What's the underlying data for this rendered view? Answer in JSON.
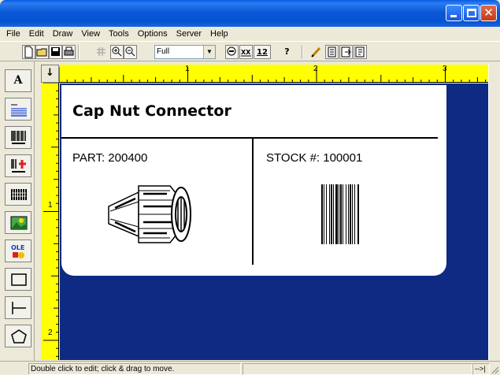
{
  "menubar": {
    "items": [
      "File",
      "Edit",
      "Draw",
      "View",
      "Tools",
      "Options",
      "Server",
      "Help"
    ]
  },
  "toolbar": {
    "zoom_value": "Full",
    "btn_12": "12",
    "btn_help": "?"
  },
  "palette": {
    "text_tool": "A"
  },
  "ruler": {
    "corner_glyph": "↓",
    "top_marks": [
      "1",
      "2",
      "3"
    ],
    "left_marks": [
      "1",
      "2"
    ]
  },
  "label": {
    "title": "Cap Nut Connector",
    "part": "PART: 200400",
    "stock": "STOCK #: 100001"
  },
  "statusbar": {
    "message": "Double click to edit; click & drag to move.",
    "right": "-->|"
  },
  "colors": {
    "canvas": "#0e2a82",
    "ruler": "#ffff00"
  }
}
